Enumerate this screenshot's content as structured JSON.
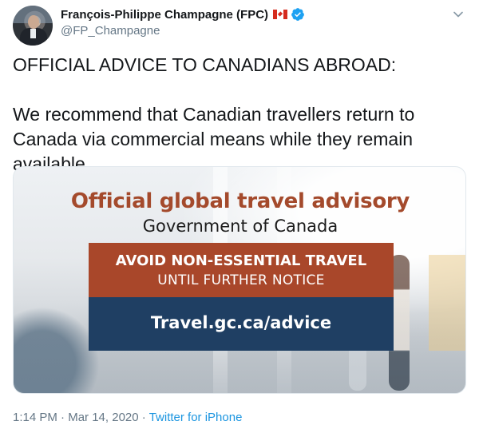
{
  "author": {
    "display_name": "François-Philippe Champagne (FPC)",
    "handle": "@FP_Champagne",
    "flag_icon": "canada-flag-icon",
    "verified_icon": "verified-badge-icon",
    "verified_color": "#1da1f2"
  },
  "tweet": {
    "line1": "OFFICIAL ADVICE TO CANADIANS ABROAD:",
    "line2": "We recommend that Canadian travellers return to Canada via commercial means while they remain available."
  },
  "image": {
    "title": "Official global travel advisory",
    "subtitle": "Government of Canada",
    "red_line1": "AVOID NON-ESSENTIAL TRAVEL",
    "red_line2": "UNTIL FURTHER NOTICE",
    "blue_line": "Travel.gc.ca/advice",
    "colors": {
      "title": "#a44a2c",
      "red_box": "#a9472a",
      "blue_box": "#1f3f63"
    }
  },
  "meta": {
    "time": "1:14 PM",
    "separator1": "·",
    "date": "Mar 14, 2020",
    "separator2": "·",
    "source": "Twitter for iPhone",
    "link_color": "#1b95e0"
  },
  "icons": {
    "menu": "chevron-down-icon"
  }
}
